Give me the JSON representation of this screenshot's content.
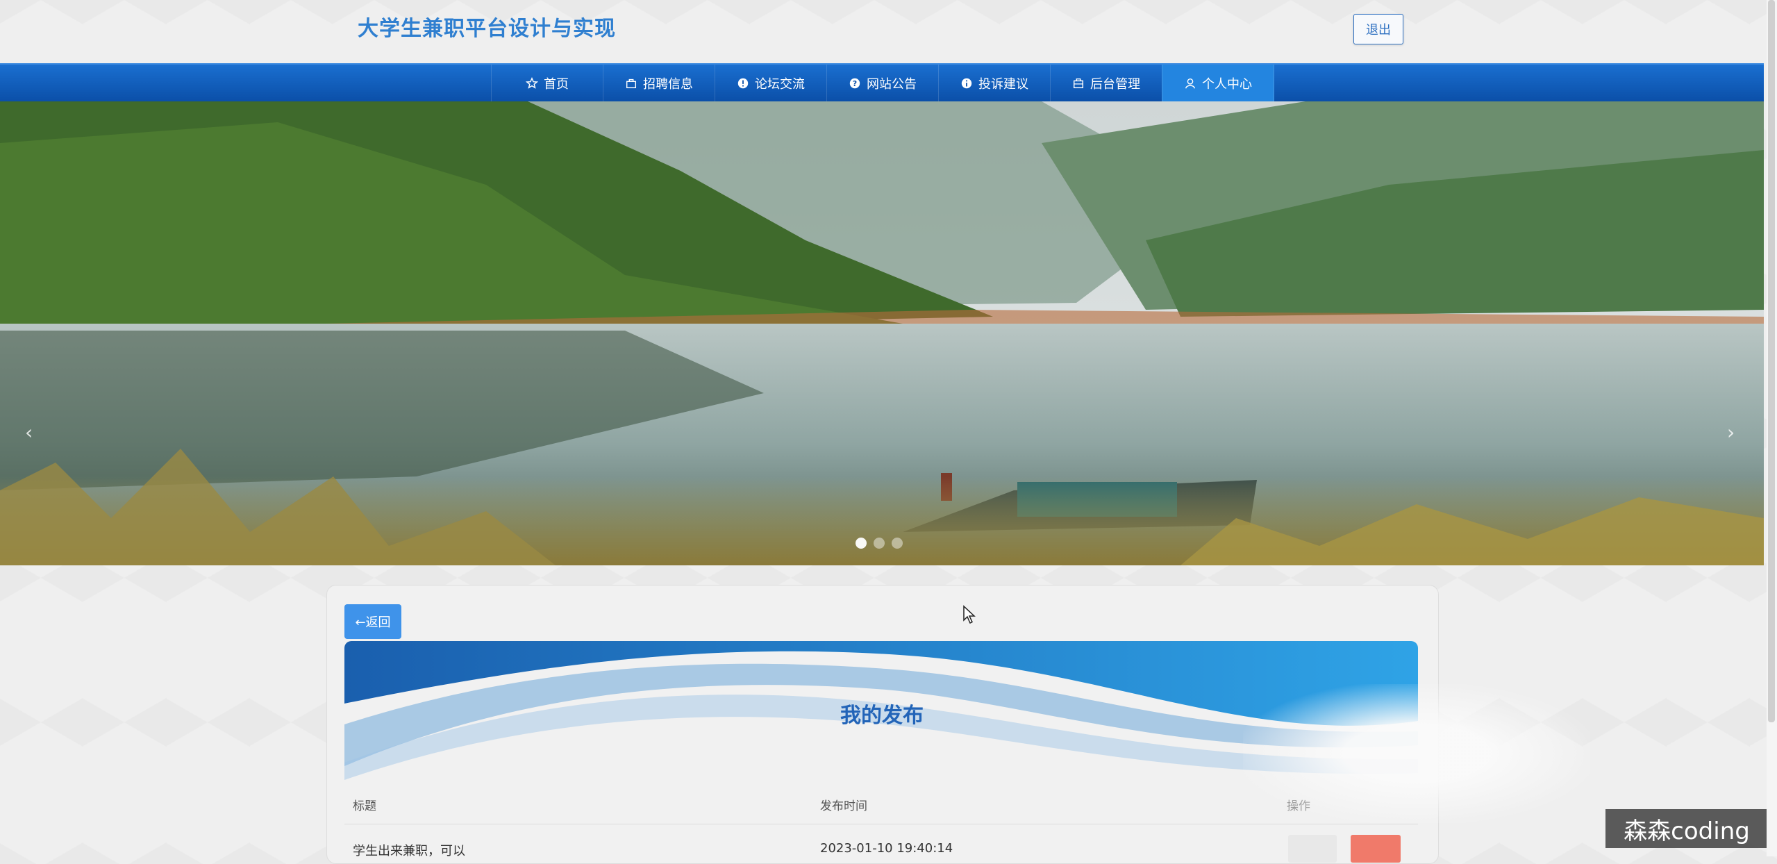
{
  "header": {
    "title": "大学生兼职平台设计与实现",
    "logout_label": "退出"
  },
  "nav": {
    "items": [
      {
        "label": "首页",
        "icon": "star-icon"
      },
      {
        "label": "招聘信息",
        "icon": "bag-icon"
      },
      {
        "label": "论坛交流",
        "icon": "info-icon"
      },
      {
        "label": "网站公告",
        "icon": "question-icon"
      },
      {
        "label": "投诉建议",
        "icon": "info-icon"
      },
      {
        "label": "后台管理",
        "icon": "briefcase-icon"
      },
      {
        "label": "个人中心",
        "icon": "user-icon",
        "active": true
      }
    ]
  },
  "banner": {
    "slides": 3,
    "active_slide": 1,
    "prev_glyph": "‹",
    "next_glyph": "›"
  },
  "content": {
    "back_label": "←返回",
    "heading": "我的发布",
    "columns": [
      "标题",
      "发布时间",
      "操作"
    ],
    "rows": [
      {
        "title": "学生出来兼职，可以",
        "time": "2023-01-10 19:40:14"
      }
    ]
  },
  "watermark": "森森coding",
  "colors": {
    "accent": "#2f7fd0",
    "nav": "#0b4fa8",
    "button": "#3f93ea",
    "danger": "#f07a6a"
  }
}
